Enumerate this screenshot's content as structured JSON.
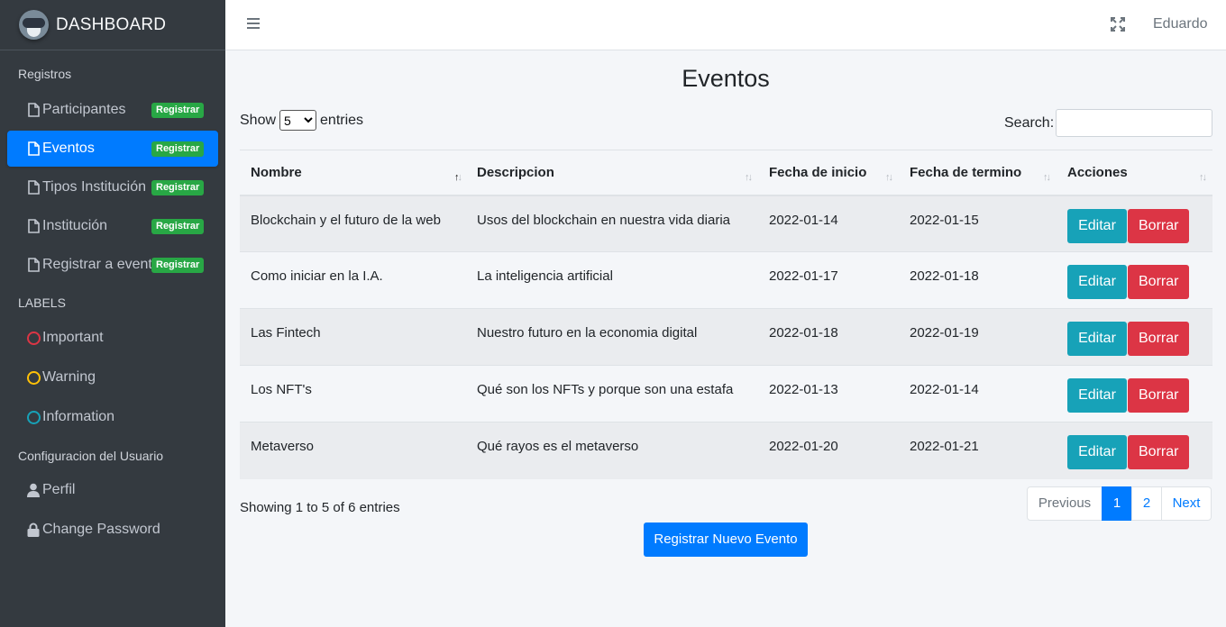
{
  "brand": {
    "title": "DASHBOARD"
  },
  "sidebar": {
    "section_registros": "Registros",
    "registros": [
      {
        "label": "Participantes",
        "badge": "Registrar",
        "active": false
      },
      {
        "label": "Eventos",
        "badge": "Registrar",
        "active": true
      },
      {
        "label": "Tipos Institución",
        "badge": "Registrar",
        "active": false
      },
      {
        "label": "Institución",
        "badge": "Registrar",
        "active": false
      },
      {
        "label": "Registrar a evento",
        "badge": "Registrar",
        "active": false
      }
    ],
    "section_labels": "LABELS",
    "labels": [
      {
        "label": "Important",
        "color": "#dc3545"
      },
      {
        "label": "Warning",
        "color": "#ffc107"
      },
      {
        "label": "Information",
        "color": "#17a2b8"
      }
    ],
    "section_user": "Configuracion del Usuario",
    "user_items": [
      {
        "label": "Perfil",
        "icon": "user-icon"
      },
      {
        "label": "Change Password",
        "icon": "lock-icon"
      }
    ]
  },
  "navbar": {
    "user": "Eduardo"
  },
  "page": {
    "title": "Eventos"
  },
  "table_controls": {
    "show_label": "Show",
    "entries_label": "entries",
    "page_size": "5",
    "search_label": "Search:",
    "search_value": ""
  },
  "table": {
    "columns": [
      "Nombre",
      "Descripcion",
      "Fecha de inicio",
      "Fecha de termino",
      "Acciones"
    ],
    "rows": [
      {
        "nombre": "Blockchain y el futuro de la web",
        "descripcion": "Usos del blockchain en nuestra vida diaria",
        "inicio": "2022-01-14",
        "termino": "2022-01-15"
      },
      {
        "nombre": "Como iniciar en la I.A.",
        "descripcion": "La inteligencia artificial",
        "inicio": "2022-01-17",
        "termino": "2022-01-18"
      },
      {
        "nombre": "Las Fintech",
        "descripcion": "Nuestro futuro en la economia digital",
        "inicio": "2022-01-18",
        "termino": "2022-01-19"
      },
      {
        "nombre": "Los NFT's",
        "descripcion": "Qué son los NFTs y porque son una estafa",
        "inicio": "2022-01-13",
        "termino": "2022-01-14"
      },
      {
        "nombre": "Metaverso",
        "descripcion": "Qué rayos es el metaverso",
        "inicio": "2022-01-20",
        "termino": "2022-01-21"
      }
    ],
    "edit_label": "Editar",
    "delete_label": "Borrar"
  },
  "footer": {
    "showing": "Showing 1 to 5 of 6 entries",
    "previous": "Previous",
    "pages": [
      "1",
      "2"
    ],
    "next": "Next",
    "new_event": "Registrar Nuevo Evento"
  }
}
